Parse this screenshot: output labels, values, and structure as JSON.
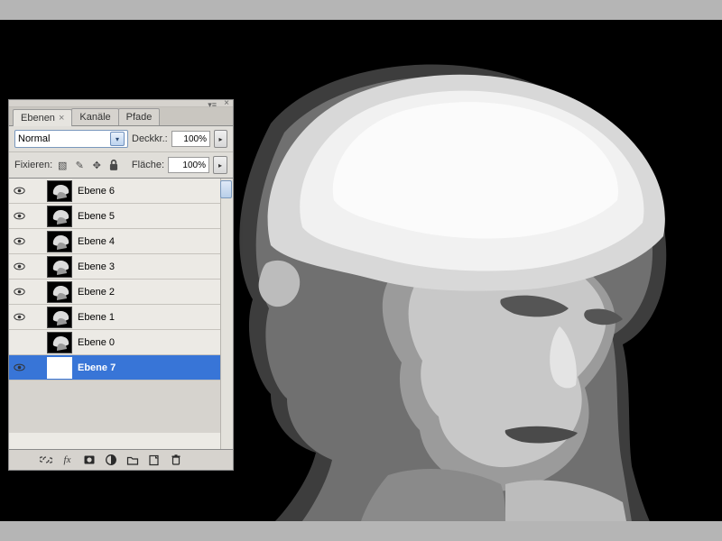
{
  "app": {
    "panel_position": "top-left",
    "canvas_bg": "#000000"
  },
  "tabs": [
    {
      "label": "Ebenen",
      "active": true,
      "closable": true
    },
    {
      "label": "Kanäle",
      "active": false,
      "closable": false
    },
    {
      "label": "Pfade",
      "active": false,
      "closable": false
    }
  ],
  "blend_row": {
    "mode": "Normal",
    "opacity_label": "Deckkr.:",
    "opacity_value": "100%"
  },
  "lock_row": {
    "label": "Fixieren:",
    "icons": [
      "transparency-lock-icon",
      "brush-lock-icon",
      "move-lock-icon",
      "full-lock-icon"
    ],
    "fill_label": "Fläche:",
    "fill_value": "100%"
  },
  "layers": [
    {
      "visible": true,
      "thumb": "portrait",
      "name": "Ebene 6",
      "selected": false
    },
    {
      "visible": true,
      "thumb": "portrait",
      "name": "Ebene 5",
      "selected": false
    },
    {
      "visible": true,
      "thumb": "portrait",
      "name": "Ebene 4",
      "selected": false
    },
    {
      "visible": true,
      "thumb": "portrait",
      "name": "Ebene 3",
      "selected": false
    },
    {
      "visible": true,
      "thumb": "portrait",
      "name": "Ebene 2",
      "selected": false
    },
    {
      "visible": true,
      "thumb": "portrait",
      "name": "Ebene 1",
      "selected": false
    },
    {
      "visible": false,
      "thumb": "portrait",
      "name": "Ebene 0",
      "selected": false
    },
    {
      "visible": true,
      "thumb": "white",
      "name": "Ebene 7",
      "selected": true
    }
  ],
  "statusbar_icons": [
    "link-icon",
    "fx-icon",
    "mask-icon",
    "adjustment-icon",
    "group-icon",
    "new-layer-icon",
    "trash-icon"
  ],
  "statusbar_labels": {
    "fx": "fx"
  }
}
